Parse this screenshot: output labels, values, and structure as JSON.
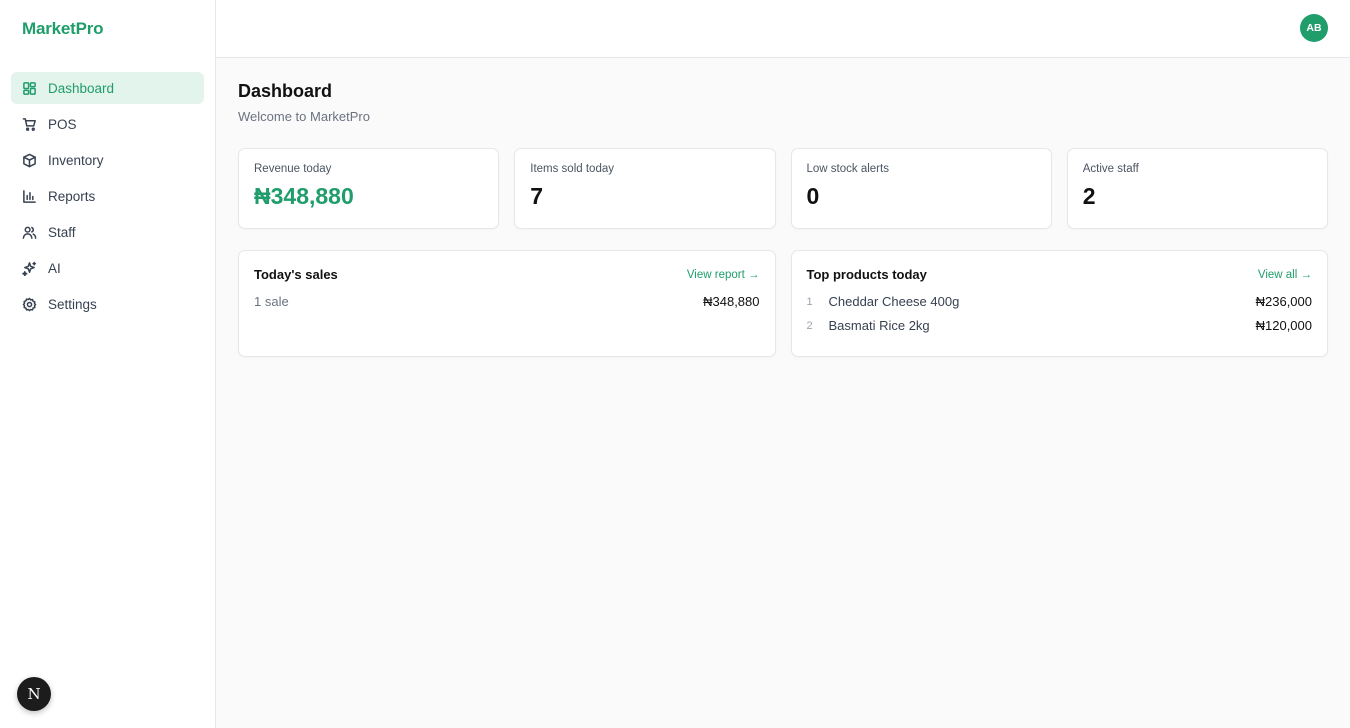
{
  "brand": "MarketPro",
  "colors": {
    "accent": "#1f9d6b",
    "active_bg": "#e3f4ec"
  },
  "sidebar": {
    "items": [
      {
        "label": "Dashboard",
        "icon": "layout-grid-icon",
        "active": true
      },
      {
        "label": "POS",
        "icon": "shopping-cart-icon",
        "active": false
      },
      {
        "label": "Inventory",
        "icon": "package-icon",
        "active": false
      },
      {
        "label": "Reports",
        "icon": "bar-chart-icon",
        "active": false
      },
      {
        "label": "Staff",
        "icon": "users-icon",
        "active": false
      },
      {
        "label": "AI",
        "icon": "sparkles-icon",
        "active": false
      },
      {
        "label": "Settings",
        "icon": "gear-icon",
        "active": false
      }
    ]
  },
  "topbar": {
    "avatar_initials": "AB"
  },
  "dev_badge": "N",
  "page": {
    "title": "Dashboard",
    "subtitle": "Welcome to MarketPro"
  },
  "stats": [
    {
      "label": "Revenue today",
      "value": "₦348,880"
    },
    {
      "label": "Items sold today",
      "value": "7"
    },
    {
      "label": "Low stock alerts",
      "value": "0"
    },
    {
      "label": "Active staff",
      "value": "2"
    }
  ],
  "sales_panel": {
    "title": "Today's sales",
    "link": "View report →",
    "count": "1 sale",
    "total": "₦348,880"
  },
  "products_panel": {
    "title": "Top products today",
    "link": "View all →",
    "items": [
      {
        "rank": "1",
        "name": "Cheddar Cheese 400g",
        "amount": "₦236,000"
      },
      {
        "rank": "2",
        "name": "Basmati Rice 2kg",
        "amount": "₦120,000"
      }
    ]
  }
}
